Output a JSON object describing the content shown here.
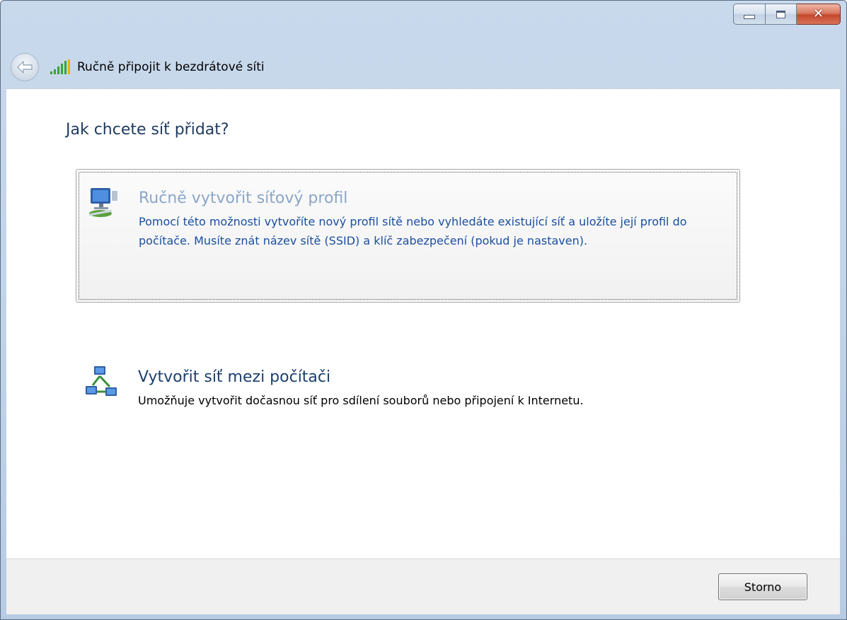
{
  "window": {
    "title": "Ručně připojit k bezdrátové síti",
    "buttons": {
      "minimize": "minimize",
      "maximize": "maximize",
      "close": "close"
    }
  },
  "main": {
    "question": "Jak chcete síť přidat?",
    "options": [
      {
        "title": "Ručně vytvořit síťový profil",
        "description": "Pomocí této možnosti vytvoříte nový profil sítě nebo vyhledáte existující síť a uložíte její profil do počítače. Musíte znát název sítě (SSID) a klíč zabezpečení (pokud je nastaven).",
        "icon": "network-profile-icon"
      },
      {
        "title": "Vytvořit síť mezi počítači",
        "description": "Umožňuje vytvořit dočasnou síť pro sdílení souborů nebo připojení k Internetu.",
        "icon": "ad-hoc-network-icon"
      }
    ]
  },
  "footer": {
    "cancel_label": "Storno"
  },
  "colors": {
    "title_bar": "#bfd2e8",
    "heading": "#1e3a5f",
    "link_blue": "#1b4fa0",
    "hover_title": "#8aa6c8",
    "close_red": "#c4472c"
  }
}
